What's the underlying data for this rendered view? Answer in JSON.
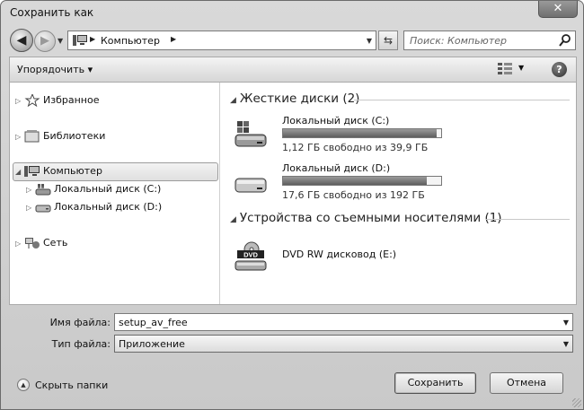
{
  "window": {
    "title": "Сохранить как",
    "close_label": "✕"
  },
  "nav": {
    "back_label": "◀",
    "forward_label": "▶",
    "address": {
      "crumb": "Компьютер"
    },
    "search_placeholder": "Поиск: Компьютер"
  },
  "toolbar": {
    "organize_label": "Упорядочить ▾",
    "help_label": "?"
  },
  "tree": {
    "favorites": "Избранное",
    "libraries": "Библиотеки",
    "computer": "Компьютер",
    "drive_c": "Локальный диск (C:)",
    "drive_d": "Локальный диск (D:)",
    "network": "Сеть"
  },
  "groups": {
    "hard_disks": "Жесткие диски (2)",
    "removable": "Устройства со съемными носителями (1)"
  },
  "drives": [
    {
      "name": "Локальный диск (C:)",
      "free": "1,12 ГБ свободно из 39,9 ГБ",
      "used_fraction": 0.972
    },
    {
      "name": "Локальный диск (D:)",
      "free": "17,6 ГБ свободно из 192 ГБ",
      "used_fraction": 0.908
    },
    {
      "name": "DVD RW дисковод (E:)",
      "badge": "DVD"
    }
  ],
  "form": {
    "filename_label": "Имя файла:",
    "filename_value": "setup_av_free",
    "filetype_label": "Тип файла:",
    "filetype_value": "Приложение"
  },
  "footer": {
    "hide_folders_label": "Скрыть папки",
    "save_label": "Сохранить",
    "cancel_label": "Отмена"
  }
}
